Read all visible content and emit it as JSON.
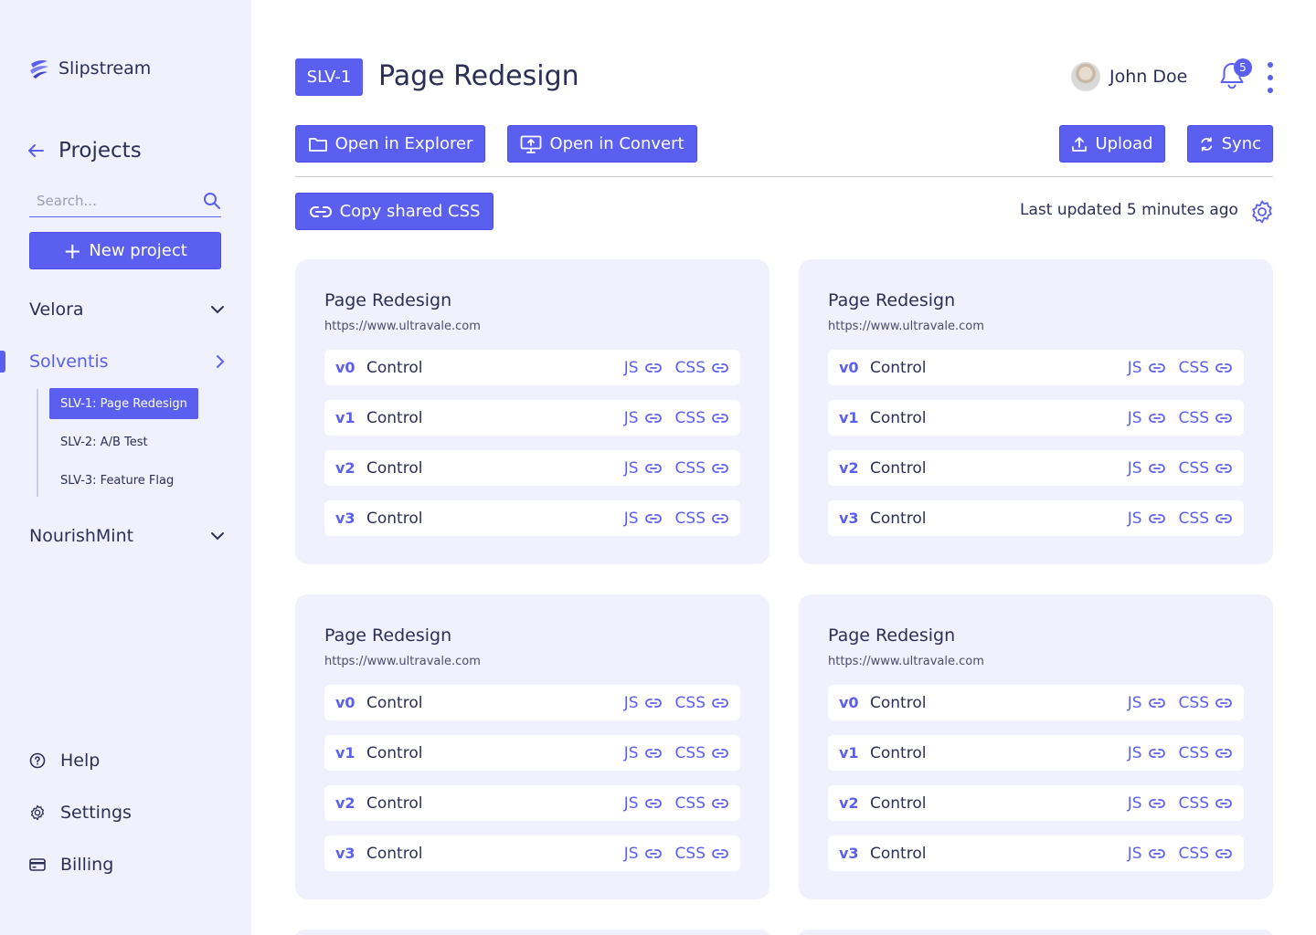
{
  "app": {
    "name": "Slipstream"
  },
  "sidebar": {
    "projects_label": "Projects",
    "search_placeholder": "Search...",
    "new_project_label": "New project",
    "groups": [
      {
        "name": "Velora",
        "expanded": false
      },
      {
        "name": "Solventis",
        "expanded": true,
        "active": true
      },
      {
        "name": "NourishMint",
        "expanded": false
      }
    ],
    "subitems": [
      {
        "label": "SLV-1: Page Redesign",
        "selected": true
      },
      {
        "label": "SLV-2: A/B Test",
        "selected": false
      },
      {
        "label": "SLV-3: Feature Flag",
        "selected": false
      }
    ],
    "footer": [
      {
        "label": "Help",
        "icon": "help-circle-icon"
      },
      {
        "label": "Settings",
        "icon": "gear-icon"
      },
      {
        "label": "Billing",
        "icon": "credit-card-icon"
      }
    ]
  },
  "header": {
    "tag": "SLV-1",
    "title": "Page Redesign",
    "user_name": "John Doe",
    "notification_count": "5"
  },
  "toolbar": {
    "open_explorer": "Open in Explorer",
    "open_convert": "Open in Convert",
    "upload": "Upload",
    "sync": "Sync",
    "copy_css": "Copy shared CSS",
    "last_updated": "Last updated 5 minutes ago"
  },
  "colors": {
    "accent": "#5b5ff0",
    "sidebar_bg": "#f0f1fc",
    "card_bg": "#f0f1fc",
    "text": "#2b2f56"
  },
  "cards": [
    {
      "title": "Page Redesign",
      "url": "https://www.ultravale.com",
      "variants": [
        {
          "ver": "v0",
          "name": "Control",
          "js": "JS",
          "css": "CSS"
        },
        {
          "ver": "v1",
          "name": "Control",
          "js": "JS",
          "css": "CSS"
        },
        {
          "ver": "v2",
          "name": "Control",
          "js": "JS",
          "css": "CSS"
        },
        {
          "ver": "v3",
          "name": "Control",
          "js": "JS",
          "css": "CSS"
        }
      ]
    },
    {
      "title": "Page Redesign",
      "url": "https://www.ultravale.com",
      "variants": [
        {
          "ver": "v0",
          "name": "Control",
          "js": "JS",
          "css": "CSS"
        },
        {
          "ver": "v1",
          "name": "Control",
          "js": "JS",
          "css": "CSS"
        },
        {
          "ver": "v2",
          "name": "Control",
          "js": "JS",
          "css": "CSS"
        },
        {
          "ver": "v3",
          "name": "Control",
          "js": "JS",
          "css": "CSS"
        }
      ]
    },
    {
      "title": "Page Redesign",
      "url": "https://www.ultravale.com",
      "variants": [
        {
          "ver": "v0",
          "name": "Control",
          "js": "JS",
          "css": "CSS"
        },
        {
          "ver": "v1",
          "name": "Control",
          "js": "JS",
          "css": "CSS"
        },
        {
          "ver": "v2",
          "name": "Control",
          "js": "JS",
          "css": "CSS"
        },
        {
          "ver": "v3",
          "name": "Control",
          "js": "JS",
          "css": "CSS"
        }
      ]
    },
    {
      "title": "Page Redesign",
      "url": "https://www.ultravale.com",
      "variants": [
        {
          "ver": "v0",
          "name": "Control",
          "js": "JS",
          "css": "CSS"
        },
        {
          "ver": "v1",
          "name": "Control",
          "js": "JS",
          "css": "CSS"
        },
        {
          "ver": "v2",
          "name": "Control",
          "js": "JS",
          "css": "CSS"
        },
        {
          "ver": "v3",
          "name": "Control",
          "js": "JS",
          "css": "CSS"
        }
      ]
    }
  ]
}
